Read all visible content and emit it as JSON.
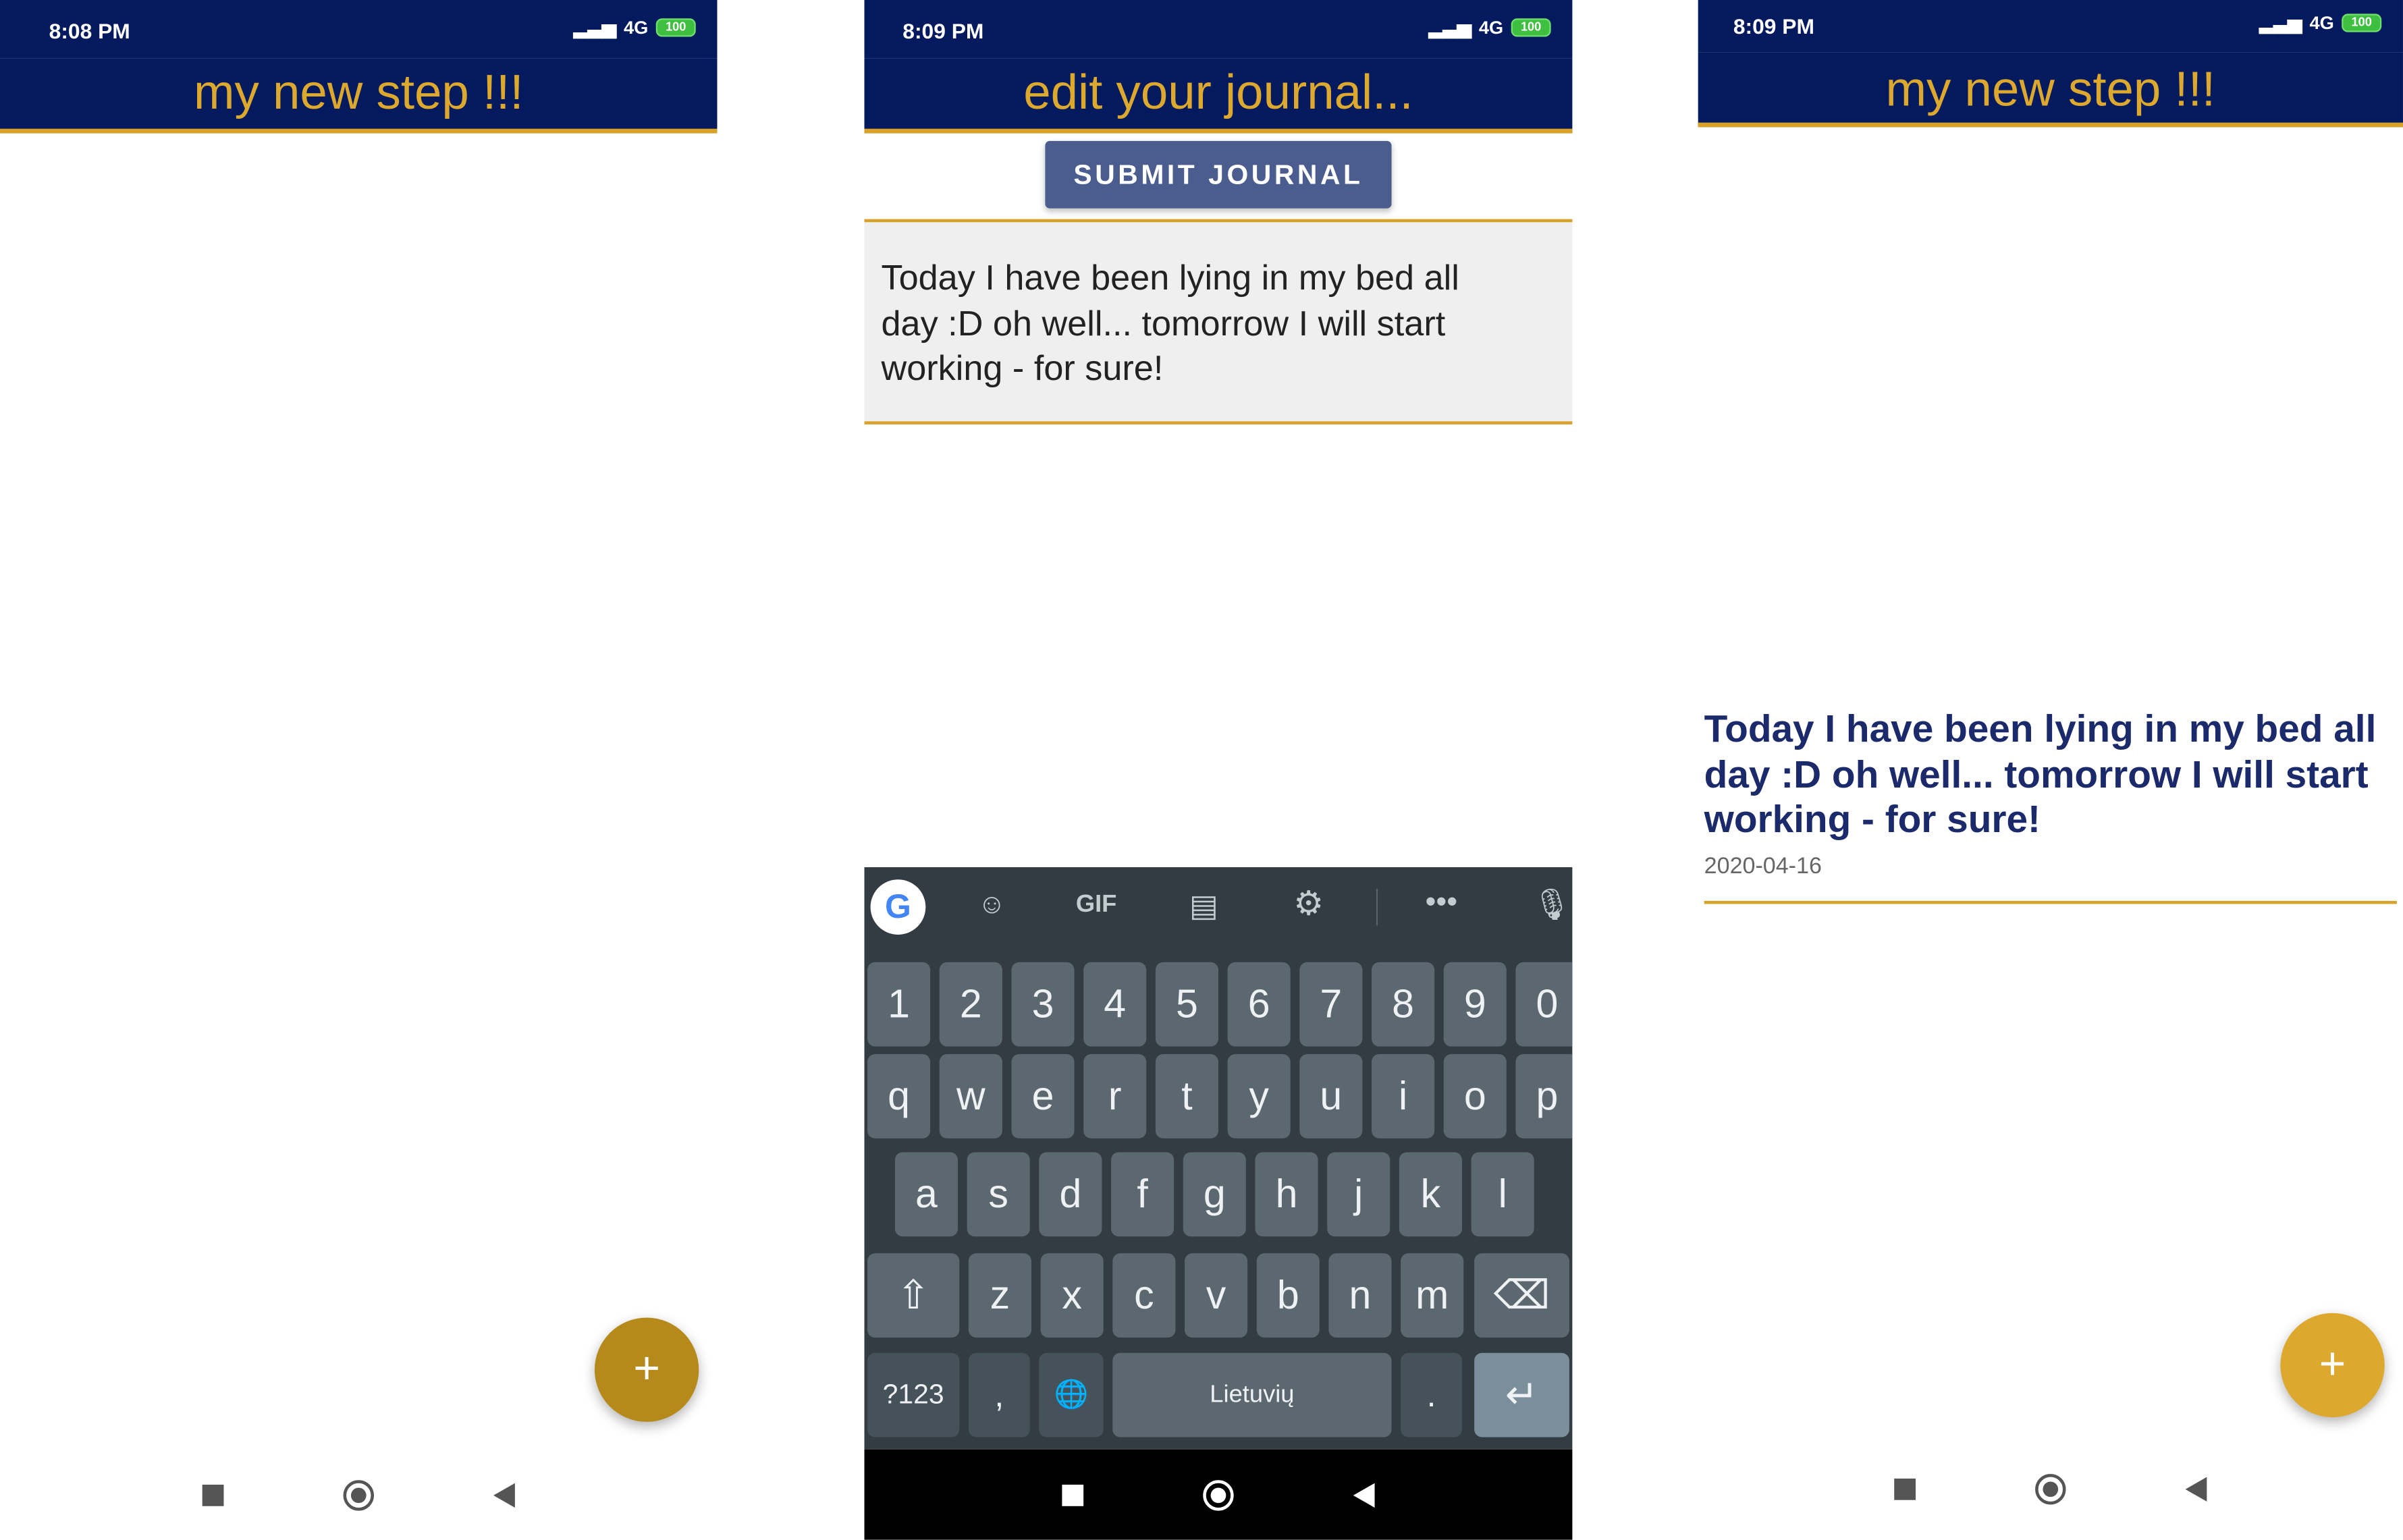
{
  "screens": [
    {
      "status": {
        "time": "8:08 PM",
        "network": "4G",
        "battery": "100"
      },
      "title": "my new step !!!",
      "fab_label": "+",
      "fab_color": "#b58a1b"
    },
    {
      "status": {
        "time": "8:09 PM",
        "network": "4G",
        "battery": "100"
      },
      "title": "edit your journal...",
      "submit_label": "SUBMIT JOURNAL",
      "editor_text": "Today I have been lying in my bed all day :D oh well... tomorrow I will start working - for sure!",
      "keyboard": {
        "toolbar": [
          "google-icon",
          "sticker-icon",
          "GIF",
          "clipboard-icon",
          "gear-icon",
          "more-icon",
          "mic-icon"
        ],
        "gif_label": "GIF",
        "row_numbers": [
          "1",
          "2",
          "3",
          "4",
          "5",
          "6",
          "7",
          "8",
          "9",
          "0"
        ],
        "row1": [
          "q",
          "w",
          "e",
          "r",
          "t",
          "y",
          "u",
          "i",
          "o",
          "p"
        ],
        "row2": [
          "a",
          "s",
          "d",
          "f",
          "g",
          "h",
          "j",
          "k",
          "l"
        ],
        "row3": [
          "z",
          "x",
          "c",
          "v",
          "b",
          "n",
          "m"
        ],
        "symbols_label": "?123",
        "comma_label": ",",
        "space_label": "Lietuvių",
        "period_label": "."
      }
    },
    {
      "status": {
        "time": "8:09 PM",
        "network": "4G",
        "battery": "100"
      },
      "title": "my new step !!!",
      "entries": [
        {
          "text": "Today I have been lying in my bed all day :D oh well... tomorrow I will start working - for sure!",
          "date": "2020-04-16"
        }
      ],
      "fab_label": "+",
      "fab_color": "#dca82e"
    }
  ],
  "colors": {
    "header": "#041a5e",
    "accent": "#d8a228"
  }
}
